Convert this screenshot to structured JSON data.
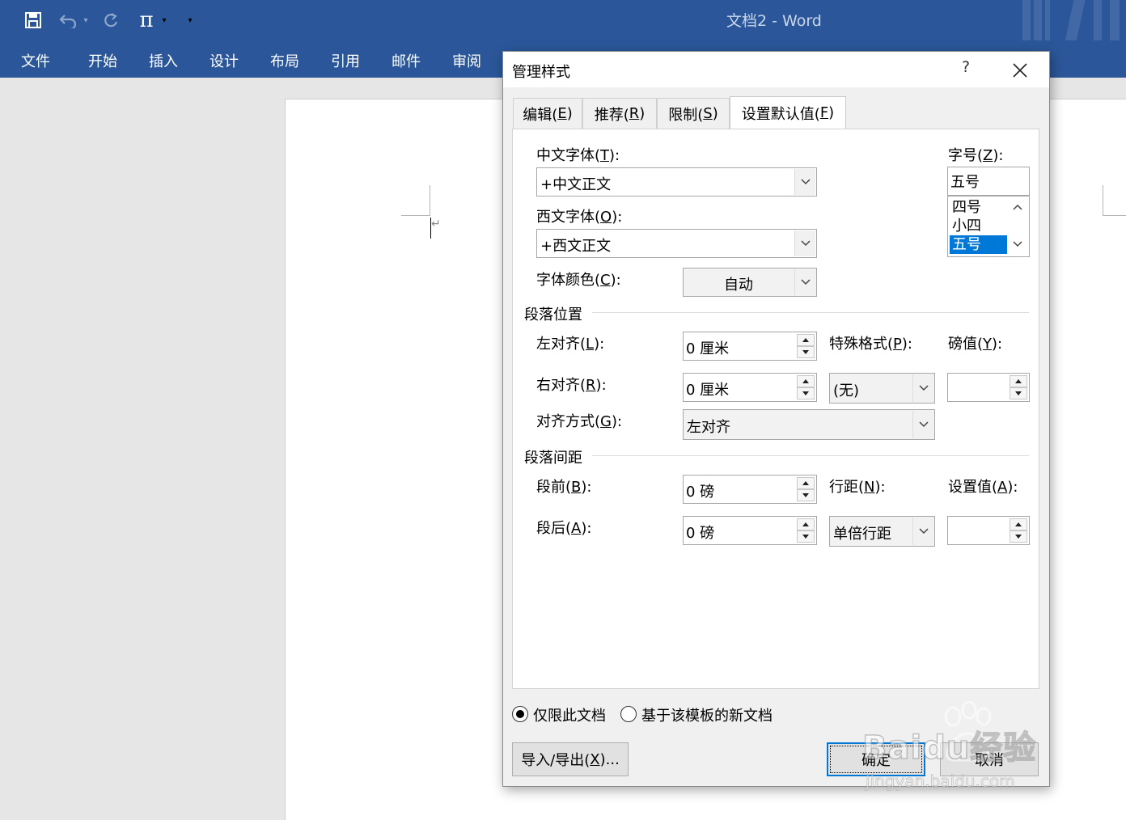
{
  "word": {
    "doc_title": "文档2 - Word",
    "qat": {
      "undo_arrow": "▾",
      "equation_glyph": "π",
      "equation_arrow": "▾",
      "customize_arrow": "▾"
    },
    "menu": [
      "文件",
      "开始",
      "插入",
      "设计",
      "布局",
      "引用",
      "邮件",
      "审阅"
    ]
  },
  "dialog": {
    "title": "管理样式",
    "help": "?",
    "tabs": [
      {
        "label": "编辑(",
        "key": "E",
        "tail": ")"
      },
      {
        "label": "推荐(",
        "key": "R",
        "tail": ")"
      },
      {
        "label": "限制(",
        "key": "S",
        "tail": ")"
      },
      {
        "label": "设置默认值(",
        "key": "F",
        "tail": ")"
      }
    ],
    "font": {
      "cn_label": "中文字体(",
      "cn_key": "T",
      "cn_tail": "):",
      "cn_value": "+中文正文",
      "west_label": "西文字体(",
      "west_key": "O",
      "west_tail": "):",
      "west_value": "+西文正文",
      "color_label": "字体颜色(",
      "color_key": "C",
      "color_tail": "):",
      "color_value": "自动",
      "size_label": "字号(",
      "size_key": "Z",
      "size_tail": "):",
      "size_value": "五号",
      "size_options": [
        "四号",
        "小四",
        "五号"
      ],
      "size_selected": "五号"
    },
    "paragraph_position": {
      "heading": "段落位置",
      "left_label": "左对齐(",
      "left_key": "L",
      "left_tail": "):",
      "left_value": "0 厘米",
      "right_label": "右对齐(",
      "right_key": "R",
      "right_tail": "):",
      "right_value": "0 厘米",
      "special_label": "特殊格式(",
      "special_key": "P",
      "special_tail": "):",
      "special_value": "(无)",
      "by_label": "磅值(",
      "by_key": "Y",
      "by_tail": "):",
      "by_value": "",
      "align_label": "对齐方式(",
      "align_key": "G",
      "align_tail": "):",
      "align_value": "左对齐"
    },
    "paragraph_spacing": {
      "heading": "段落间距",
      "before_label": "段前(",
      "before_key": "B",
      "before_tail": "):",
      "before_value": "0 磅",
      "after_label": "段后(",
      "after_key": "A",
      "after_tail": "):",
      "after_value": "0 磅",
      "line_label": "行距(",
      "line_key": "N",
      "line_tail": "):",
      "line_value": "单倍行距",
      "at_label": "设置值(",
      "at_key": "A",
      "at_tail": "):",
      "at_value": ""
    },
    "scope": {
      "this_doc": "仅限此文档",
      "template": "基于该模板的新文档",
      "selected": "this_doc"
    },
    "buttons": {
      "import_export": "导入/导出(",
      "import_export_key": "X",
      "import_export_tail": ")...",
      "ok": "确定",
      "cancel": "取消"
    }
  },
  "watermark": {
    "brand": "Baidu经验",
    "url": "jingyan.baidu.com"
  },
  "colors": {
    "ribbon": "#2b579a",
    "selection": "#0078d7",
    "default_button_border": "#0078d7"
  }
}
